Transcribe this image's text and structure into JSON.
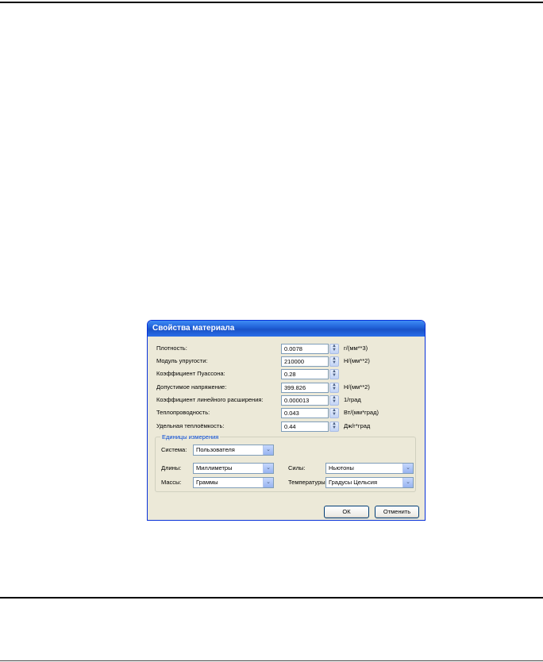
{
  "dialog": {
    "title": "Свойства материала",
    "properties": [
      {
        "label": "Плотность:",
        "value": "0.0078",
        "unit": "г/(мм**3)"
      },
      {
        "label": "Модуль упругости:",
        "value": "210000",
        "unit": "Н/(мм**2)"
      },
      {
        "label": "Коэффициент Пуассона:",
        "value": "0.28",
        "unit": ""
      },
      {
        "label": "Допустимое напряжение:",
        "value": "399.826",
        "unit": "Н/(мм**2)"
      },
      {
        "label": "Коэффициент линейного расширения:",
        "value": "0.000013",
        "unit": "1/град"
      },
      {
        "label": "Теплопроводность:",
        "value": "0.043",
        "unit": "Вт/(мм*град)"
      },
      {
        "label": "Удельная теплоёмкость:",
        "value": "0.44",
        "unit": "Дж/г*град"
      }
    ],
    "units_group": {
      "legend": "Единицы измерения",
      "system_label": "Система:",
      "system_value": "Пользователя",
      "length_label": "Длины:",
      "length_value": "Миллиметры",
      "mass_label": "Массы:",
      "mass_value": "Граммы",
      "force_label": "Силы:",
      "force_value": "Ньютоны",
      "temp_label": "Температуры:",
      "temp_value": "Градусы Цельсия"
    },
    "ok_label": "ОК",
    "cancel_label": "Отменить"
  }
}
